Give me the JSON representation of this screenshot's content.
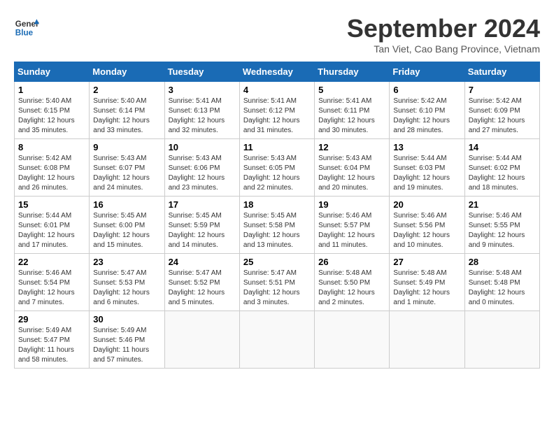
{
  "header": {
    "logo_line1": "General",
    "logo_line2": "Blue",
    "title": "September 2024",
    "subtitle": "Tan Viet, Cao Bang Province, Vietnam"
  },
  "calendar": {
    "weekdays": [
      "Sunday",
      "Monday",
      "Tuesday",
      "Wednesday",
      "Thursday",
      "Friday",
      "Saturday"
    ],
    "weeks": [
      [
        {
          "day": "1",
          "info": "Sunrise: 5:40 AM\nSunset: 6:15 PM\nDaylight: 12 hours\nand 35 minutes."
        },
        {
          "day": "2",
          "info": "Sunrise: 5:40 AM\nSunset: 6:14 PM\nDaylight: 12 hours\nand 33 minutes."
        },
        {
          "day": "3",
          "info": "Sunrise: 5:41 AM\nSunset: 6:13 PM\nDaylight: 12 hours\nand 32 minutes."
        },
        {
          "day": "4",
          "info": "Sunrise: 5:41 AM\nSunset: 6:12 PM\nDaylight: 12 hours\nand 31 minutes."
        },
        {
          "day": "5",
          "info": "Sunrise: 5:41 AM\nSunset: 6:11 PM\nDaylight: 12 hours\nand 30 minutes."
        },
        {
          "day": "6",
          "info": "Sunrise: 5:42 AM\nSunset: 6:10 PM\nDaylight: 12 hours\nand 28 minutes."
        },
        {
          "day": "7",
          "info": "Sunrise: 5:42 AM\nSunset: 6:09 PM\nDaylight: 12 hours\nand 27 minutes."
        }
      ],
      [
        {
          "day": "8",
          "info": "Sunrise: 5:42 AM\nSunset: 6:08 PM\nDaylight: 12 hours\nand 26 minutes."
        },
        {
          "day": "9",
          "info": "Sunrise: 5:43 AM\nSunset: 6:07 PM\nDaylight: 12 hours\nand 24 minutes."
        },
        {
          "day": "10",
          "info": "Sunrise: 5:43 AM\nSunset: 6:06 PM\nDaylight: 12 hours\nand 23 minutes."
        },
        {
          "day": "11",
          "info": "Sunrise: 5:43 AM\nSunset: 6:05 PM\nDaylight: 12 hours\nand 22 minutes."
        },
        {
          "day": "12",
          "info": "Sunrise: 5:43 AM\nSunset: 6:04 PM\nDaylight: 12 hours\nand 20 minutes."
        },
        {
          "day": "13",
          "info": "Sunrise: 5:44 AM\nSunset: 6:03 PM\nDaylight: 12 hours\nand 19 minutes."
        },
        {
          "day": "14",
          "info": "Sunrise: 5:44 AM\nSunset: 6:02 PM\nDaylight: 12 hours\nand 18 minutes."
        }
      ],
      [
        {
          "day": "15",
          "info": "Sunrise: 5:44 AM\nSunset: 6:01 PM\nDaylight: 12 hours\nand 17 minutes."
        },
        {
          "day": "16",
          "info": "Sunrise: 5:45 AM\nSunset: 6:00 PM\nDaylight: 12 hours\nand 15 minutes."
        },
        {
          "day": "17",
          "info": "Sunrise: 5:45 AM\nSunset: 5:59 PM\nDaylight: 12 hours\nand 14 minutes."
        },
        {
          "day": "18",
          "info": "Sunrise: 5:45 AM\nSunset: 5:58 PM\nDaylight: 12 hours\nand 13 minutes."
        },
        {
          "day": "19",
          "info": "Sunrise: 5:46 AM\nSunset: 5:57 PM\nDaylight: 12 hours\nand 11 minutes."
        },
        {
          "day": "20",
          "info": "Sunrise: 5:46 AM\nSunset: 5:56 PM\nDaylight: 12 hours\nand 10 minutes."
        },
        {
          "day": "21",
          "info": "Sunrise: 5:46 AM\nSunset: 5:55 PM\nDaylight: 12 hours\nand 9 minutes."
        }
      ],
      [
        {
          "day": "22",
          "info": "Sunrise: 5:46 AM\nSunset: 5:54 PM\nDaylight: 12 hours\nand 7 minutes."
        },
        {
          "day": "23",
          "info": "Sunrise: 5:47 AM\nSunset: 5:53 PM\nDaylight: 12 hours\nand 6 minutes."
        },
        {
          "day": "24",
          "info": "Sunrise: 5:47 AM\nSunset: 5:52 PM\nDaylight: 12 hours\nand 5 minutes."
        },
        {
          "day": "25",
          "info": "Sunrise: 5:47 AM\nSunset: 5:51 PM\nDaylight: 12 hours\nand 3 minutes."
        },
        {
          "day": "26",
          "info": "Sunrise: 5:48 AM\nSunset: 5:50 PM\nDaylight: 12 hours\nand 2 minutes."
        },
        {
          "day": "27",
          "info": "Sunrise: 5:48 AM\nSunset: 5:49 PM\nDaylight: 12 hours\nand 1 minute."
        },
        {
          "day": "28",
          "info": "Sunrise: 5:48 AM\nSunset: 5:48 PM\nDaylight: 12 hours\nand 0 minutes."
        }
      ],
      [
        {
          "day": "29",
          "info": "Sunrise: 5:49 AM\nSunset: 5:47 PM\nDaylight: 11 hours\nand 58 minutes."
        },
        {
          "day": "30",
          "info": "Sunrise: 5:49 AM\nSunset: 5:46 PM\nDaylight: 11 hours\nand 57 minutes."
        },
        {
          "day": "",
          "info": ""
        },
        {
          "day": "",
          "info": ""
        },
        {
          "day": "",
          "info": ""
        },
        {
          "day": "",
          "info": ""
        },
        {
          "day": "",
          "info": ""
        }
      ]
    ]
  }
}
